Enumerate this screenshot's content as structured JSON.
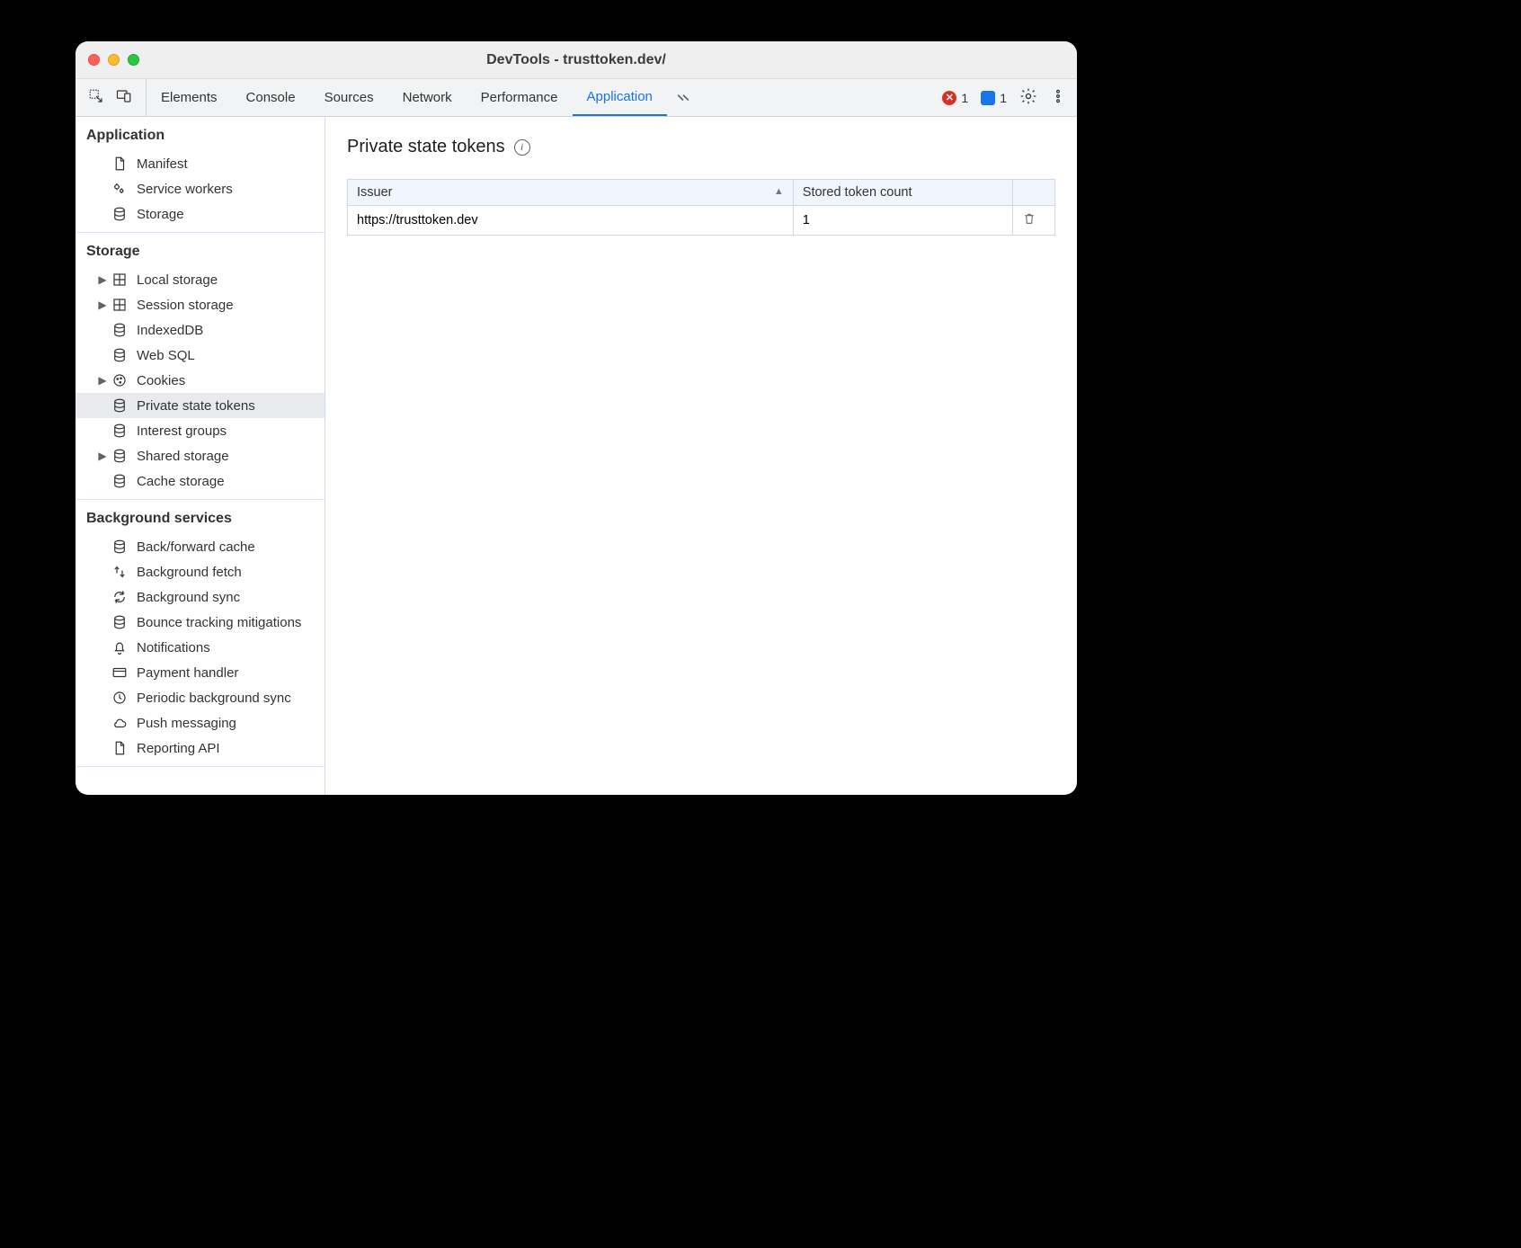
{
  "window": {
    "title": "DevTools - trusttoken.dev/"
  },
  "toolbar": {
    "tabs": [
      "Elements",
      "Console",
      "Sources",
      "Network",
      "Performance",
      "Application"
    ],
    "active_tab": 5,
    "errors_count": "1",
    "messages_count": "1"
  },
  "sidebar": {
    "sections": [
      {
        "title": "Application",
        "items": [
          {
            "label": "Manifest",
            "icon": "file-icon",
            "expandable": false
          },
          {
            "label": "Service workers",
            "icon": "gears-icon",
            "expandable": false
          },
          {
            "label": "Storage",
            "icon": "database-icon",
            "expandable": false
          }
        ]
      },
      {
        "title": "Storage",
        "items": [
          {
            "label": "Local storage",
            "icon": "grid-icon",
            "expandable": true
          },
          {
            "label": "Session storage",
            "icon": "grid-icon",
            "expandable": true
          },
          {
            "label": "IndexedDB",
            "icon": "database-icon",
            "expandable": false
          },
          {
            "label": "Web SQL",
            "icon": "database-icon",
            "expandable": false
          },
          {
            "label": "Cookies",
            "icon": "cookie-icon",
            "expandable": true
          },
          {
            "label": "Private state tokens",
            "icon": "database-icon",
            "expandable": false,
            "selected": true
          },
          {
            "label": "Interest groups",
            "icon": "database-icon",
            "expandable": false
          },
          {
            "label": "Shared storage",
            "icon": "database-icon",
            "expandable": true
          },
          {
            "label": "Cache storage",
            "icon": "database-icon",
            "expandable": false
          }
        ]
      },
      {
        "title": "Background services",
        "items": [
          {
            "label": "Back/forward cache",
            "icon": "database-icon",
            "expandable": false
          },
          {
            "label": "Background fetch",
            "icon": "fetch-icon",
            "expandable": false
          },
          {
            "label": "Background sync",
            "icon": "sync-icon",
            "expandable": false
          },
          {
            "label": "Bounce tracking mitigations",
            "icon": "database-icon",
            "expandable": false
          },
          {
            "label": "Notifications",
            "icon": "bell-icon",
            "expandable": false
          },
          {
            "label": "Payment handler",
            "icon": "card-icon",
            "expandable": false
          },
          {
            "label": "Periodic background sync",
            "icon": "clock-icon",
            "expandable": false
          },
          {
            "label": "Push messaging",
            "icon": "cloud-icon",
            "expandable": false
          },
          {
            "label": "Reporting API",
            "icon": "file-icon",
            "expandable": false
          }
        ]
      }
    ]
  },
  "main": {
    "heading": "Private state tokens",
    "columns": [
      "Issuer",
      "Stored token count"
    ],
    "rows": [
      {
        "issuer": "https://trusttoken.dev",
        "count": "1"
      }
    ]
  }
}
